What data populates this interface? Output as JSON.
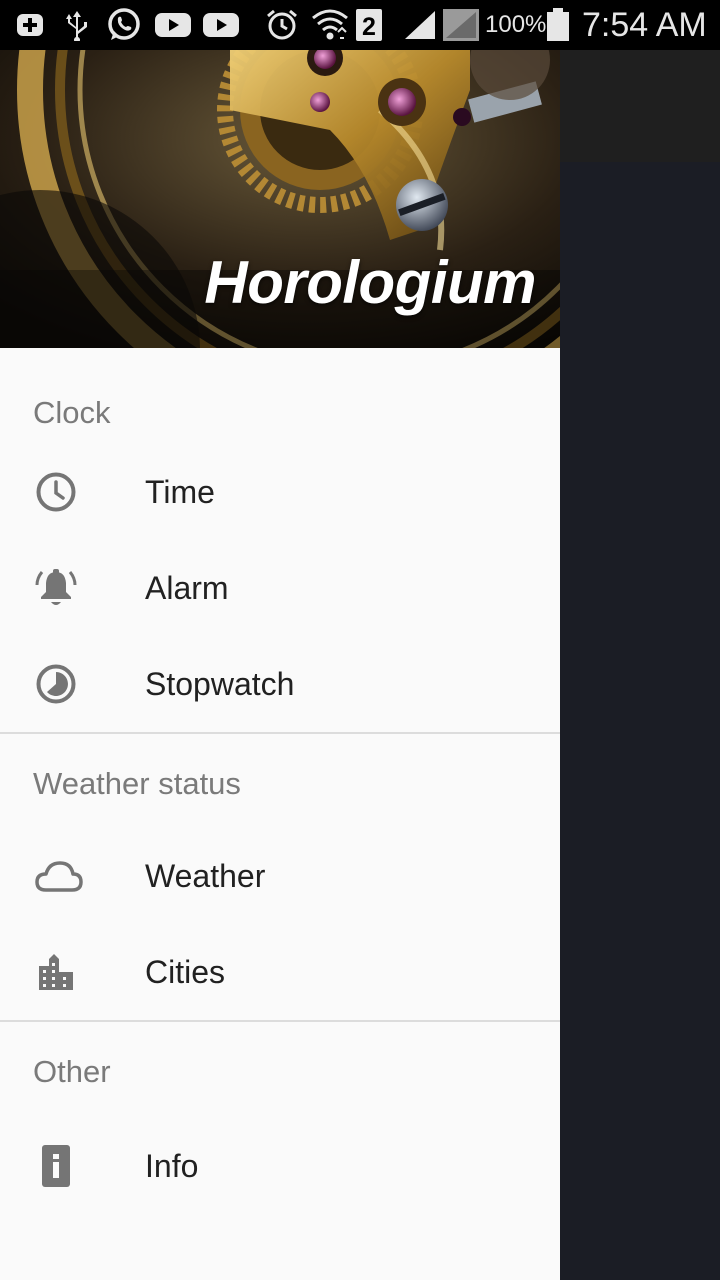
{
  "status_bar": {
    "battery_percent": "100%",
    "time": "7:54 AM",
    "sim_slot": "2",
    "icons": [
      "plus-icon",
      "usb-icon",
      "whatsapp-icon",
      "youtube-icon",
      "youtube-icon",
      "alarm-clock-icon",
      "wifi-icon",
      "sim-2-icon",
      "signal-icon",
      "signal-icon",
      "battery-icon"
    ]
  },
  "drawer": {
    "app_name": "Horologium",
    "sections": [
      {
        "title": "Clock",
        "items": [
          {
            "label": "Time",
            "icon": "clock-icon"
          },
          {
            "label": "Alarm",
            "icon": "alarm-bell-icon"
          },
          {
            "label": "Stopwatch",
            "icon": "stopwatch-icon"
          }
        ]
      },
      {
        "title": "Weather status",
        "items": [
          {
            "label": "Weather",
            "icon": "cloud-icon"
          },
          {
            "label": "Cities",
            "icon": "city-icon"
          }
        ]
      },
      {
        "title": "Other",
        "items": [
          {
            "label": "Info",
            "icon": "info-icon"
          }
        ]
      }
    ]
  },
  "colors": {
    "drawer_bg": "#fafafa",
    "section_title": "#7a7a7a",
    "item_text": "#212121",
    "icon": "#757575",
    "scrim": "#1b1d25",
    "toolbar": "#1f1f1f"
  }
}
